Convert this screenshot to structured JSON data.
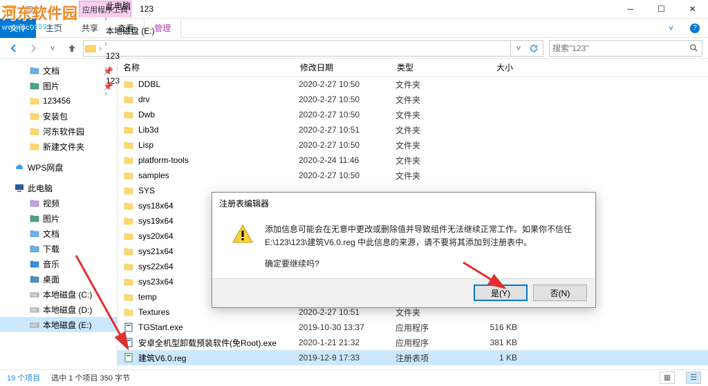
{
  "window": {
    "title": "123",
    "context_tab_group": "应用程序工具",
    "min_title": "",
    "tabs": {
      "file": "文件",
      "home": "主页",
      "share": "共享",
      "view": "查看",
      "manage": "管理"
    }
  },
  "watermark": {
    "name": "河东软件园",
    "site": "www.pc0359.cn"
  },
  "breadcrumbs": [
    {
      "id": "this-pc",
      "label": "此电脑"
    },
    {
      "id": "drive-e",
      "label": "本地磁盘 (E:)"
    },
    {
      "id": "folder-123a",
      "label": "123"
    },
    {
      "id": "folder-123b",
      "label": "123"
    }
  ],
  "search": {
    "placeholder": "搜索\"123\""
  },
  "nav_pane": {
    "quick": [
      {
        "id": "docs",
        "label": "文档",
        "pinned": true,
        "icon": "doc"
      },
      {
        "id": "pics",
        "label": "图片",
        "pinned": true,
        "icon": "pic"
      },
      {
        "id": "123456",
        "label": "123456",
        "pinned": false,
        "icon": "folder"
      },
      {
        "id": "anzhuangbao",
        "label": "安装包",
        "pinned": false,
        "icon": "folder"
      },
      {
        "id": "hdrjy",
        "label": "河东软件园",
        "pinned": false,
        "icon": "folder"
      },
      {
        "id": "newfolder",
        "label": "新建文件夹",
        "pinned": false,
        "icon": "folder"
      }
    ],
    "wps": {
      "label": "WPS网盘"
    },
    "thispc": {
      "label": "此电脑",
      "children": [
        {
          "id": "video",
          "label": "视频",
          "icon": "video"
        },
        {
          "id": "pic2",
          "label": "图片",
          "icon": "pic"
        },
        {
          "id": "doc2",
          "label": "文档",
          "icon": "doc"
        },
        {
          "id": "download",
          "label": "下载",
          "icon": "download"
        },
        {
          "id": "music",
          "label": "音乐",
          "icon": "music"
        },
        {
          "id": "desktop",
          "label": "桌面",
          "icon": "desktop"
        },
        {
          "id": "drive-c",
          "label": "本地磁盘 (C:)",
          "icon": "drive"
        },
        {
          "id": "drive-d",
          "label": "本地磁盘 (D:)",
          "icon": "drive"
        },
        {
          "id": "drive-e2",
          "label": "本地磁盘 (E:)",
          "icon": "drive",
          "selected": true
        }
      ]
    }
  },
  "columns": {
    "name": "名称",
    "date": "修改日期",
    "type": "类型",
    "size": "大小"
  },
  "files": [
    {
      "name": "DDBL",
      "date": "2020-2-27 10:50",
      "type": "文件夹",
      "size": "",
      "icon": "folder"
    },
    {
      "name": "drv",
      "date": "2020-2-27 10:50",
      "type": "文件夹",
      "size": "",
      "icon": "folder"
    },
    {
      "name": "Dwb",
      "date": "2020-2-27 10:50",
      "type": "文件夹",
      "size": "",
      "icon": "folder"
    },
    {
      "name": "Lib3d",
      "date": "2020-2-27 10:51",
      "type": "文件夹",
      "size": "",
      "icon": "folder"
    },
    {
      "name": "Lisp",
      "date": "2020-2-27 10:50",
      "type": "文件夹",
      "size": "",
      "icon": "folder"
    },
    {
      "name": "platform-tools",
      "date": "2020-2-24 11:46",
      "type": "文件夹",
      "size": "",
      "icon": "folder"
    },
    {
      "name": "samples",
      "date": "2020-2-27 10:50",
      "type": "文件夹",
      "size": "",
      "icon": "folder"
    },
    {
      "name": "SYS",
      "date": "",
      "type": "",
      "size": "",
      "icon": "folder"
    },
    {
      "name": "sys18x64",
      "date": "",
      "type": "",
      "size": "",
      "icon": "folder"
    },
    {
      "name": "sys19x64",
      "date": "",
      "type": "",
      "size": "",
      "icon": "folder"
    },
    {
      "name": "sys20x64",
      "date": "",
      "type": "",
      "size": "",
      "icon": "folder"
    },
    {
      "name": "sys21x64",
      "date": "",
      "type": "",
      "size": "",
      "icon": "folder"
    },
    {
      "name": "sys22x64",
      "date": "",
      "type": "",
      "size": "",
      "icon": "folder"
    },
    {
      "name": "sys23x64",
      "date": "",
      "type": "",
      "size": "",
      "icon": "folder"
    },
    {
      "name": "temp",
      "date": "",
      "type": "",
      "size": "",
      "icon": "folder"
    },
    {
      "name": "Textures",
      "date": "2020-2-27 10:51",
      "type": "文件夹",
      "size": "",
      "icon": "folder"
    },
    {
      "name": "TGStart.exe",
      "date": "2019-10-30 13:37",
      "type": "应用程序",
      "size": "516 KB",
      "icon": "exe"
    },
    {
      "name": "安卓全机型卸载预装软件(免Root).exe",
      "date": "2020-1-21 21:32",
      "type": "应用程序",
      "size": "381 KB",
      "icon": "exe"
    },
    {
      "name": "建筑V6.0.reg",
      "date": "2019-12-9 17:33",
      "type": "注册表项",
      "size": "1 KB",
      "icon": "reg",
      "selected": true
    }
  ],
  "statusbar": {
    "count": "19 个项目",
    "selection": "选中 1 个项目  350 字节"
  },
  "dialog": {
    "title": "注册表编辑器",
    "line1": "添加信息可能会在无意中更改或删除值并导致组件无法继续正常工作。如果你不信任 E:\\123\\123\\建筑V6.0.reg 中此信息的来源，请不要将其添加到注册表中。",
    "line2": "确定要继续吗?",
    "yes": "是(Y)",
    "no": "否(N)"
  }
}
